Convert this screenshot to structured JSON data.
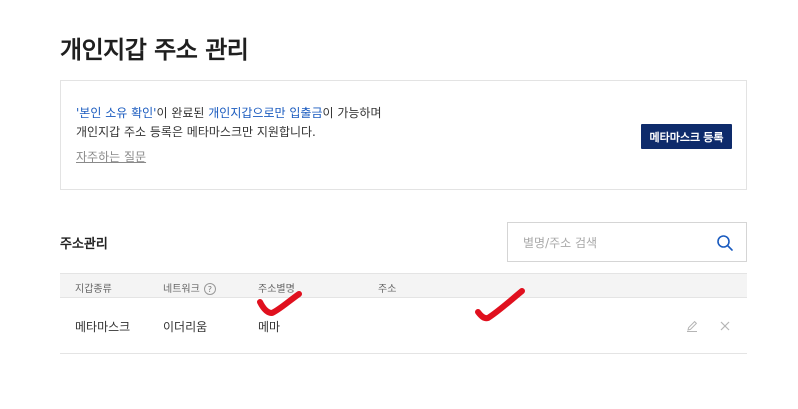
{
  "page": {
    "title": "개인지갑 주소 관리"
  },
  "notice": {
    "line1_link": "'본인 소유 확인'",
    "line1_mid": "이 완료된 ",
    "line1_highlight1": "개인지갑으로만",
    "line1_space": " ",
    "line1_highlight2": "입출금",
    "line1_end": "이 가능하며",
    "line2": "개인지갑 주소 등록은 메타마스크만 지원합니다.",
    "faq_link": "자주하는 질문",
    "register_button": "메타마스크 등록"
  },
  "section": {
    "title": "주소관리"
  },
  "search": {
    "placeholder": "별명/주소 검색",
    "value": ""
  },
  "table": {
    "headers": {
      "wallet_type": "지갑종류",
      "network": "네트워크",
      "network_help": "?",
      "nickname": "주소별명",
      "address": "주소"
    },
    "rows": [
      {
        "wallet_type": "메타마스크",
        "network": "이더리움",
        "nickname": "메마",
        "address": ""
      }
    ]
  },
  "colors": {
    "accent_blue": "#1a5bbf",
    "button_navy": "#0e2b6b",
    "annotation_red": "#e0101e"
  },
  "icons": {
    "search": "search-icon",
    "edit": "pencil-icon",
    "delete": "close-icon",
    "help": "question-circle-icon"
  }
}
